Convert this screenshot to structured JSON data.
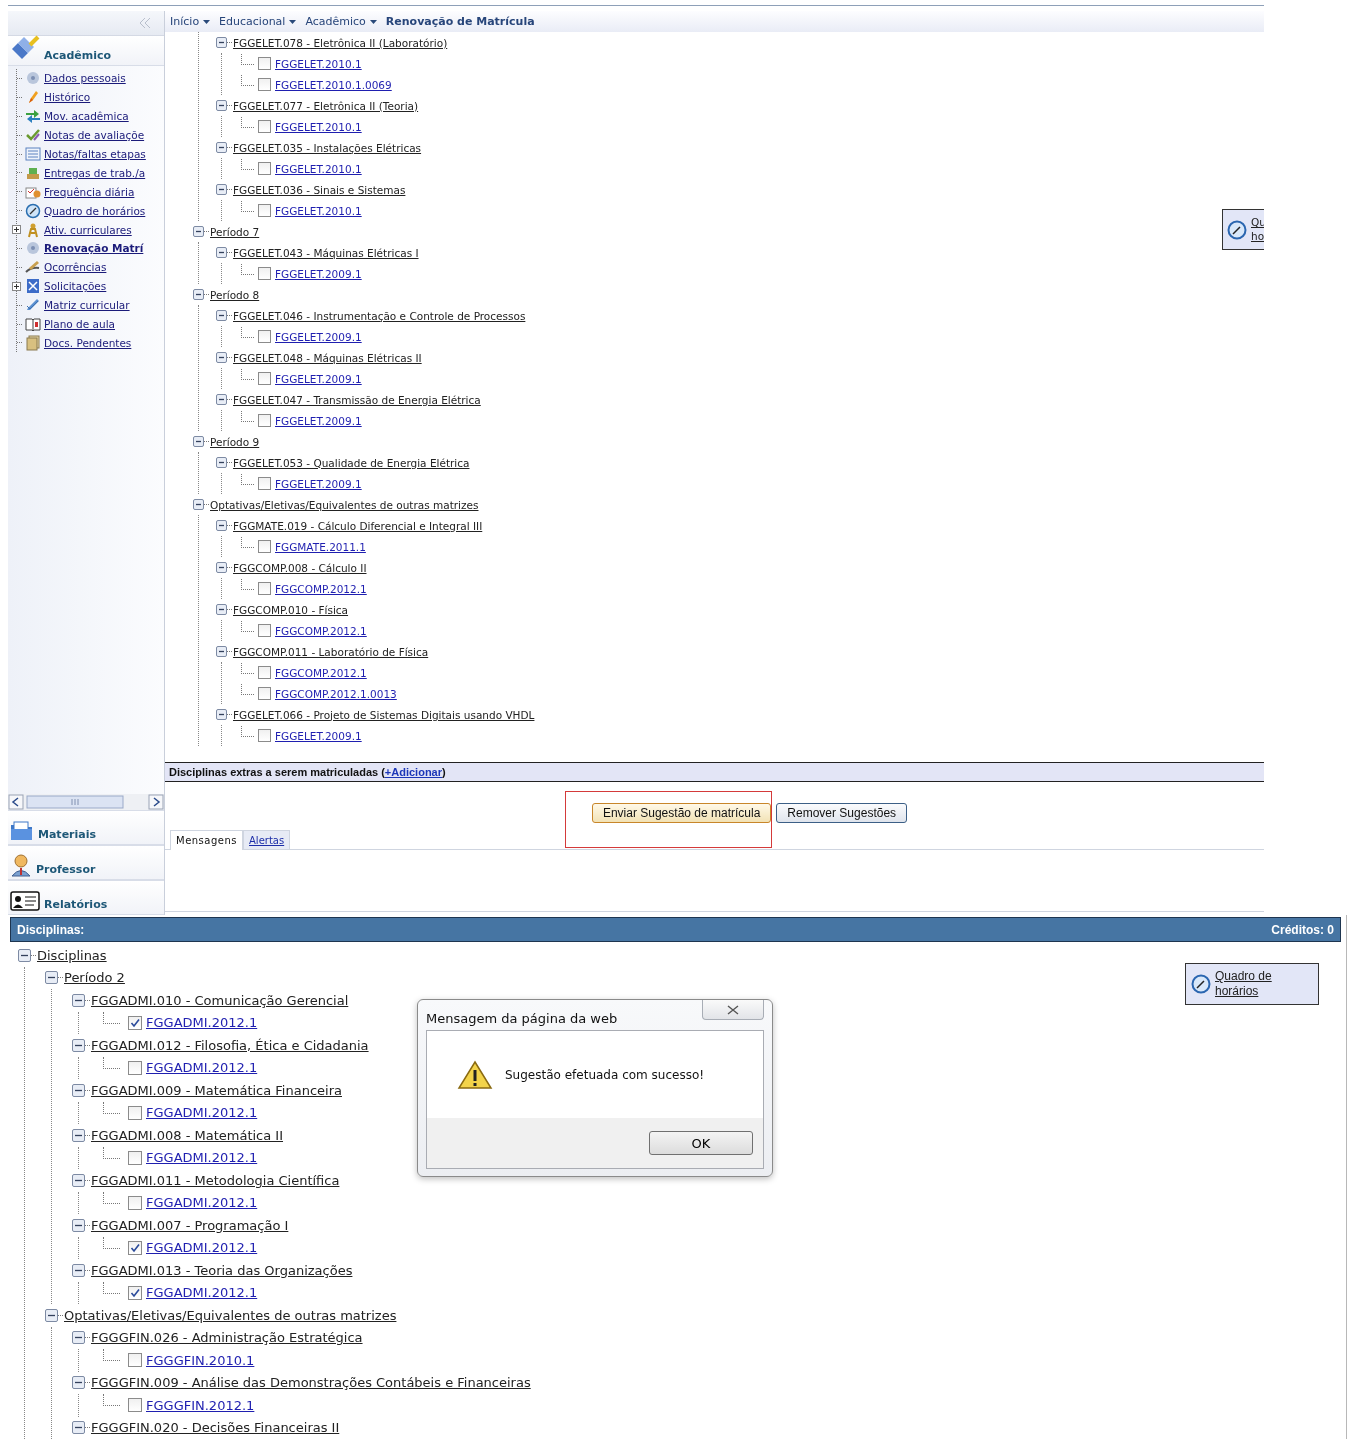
{
  "sidebar": {
    "section": {
      "title": "Acadêmico",
      "items": [
        {
          "label": "Dados pessoais",
          "expandable": false,
          "selected": false
        },
        {
          "label": "Histórico",
          "expandable": false,
          "selected": false
        },
        {
          "label": "Mov. acadêmica",
          "expandable": false,
          "selected": false
        },
        {
          "label": "Notas de avaliaçõe",
          "expandable": false,
          "selected": false
        },
        {
          "label": "Notas/faltas etapas",
          "expandable": false,
          "selected": false
        },
        {
          "label": "Entregas de trab./a",
          "expandable": false,
          "selected": false
        },
        {
          "label": "Frequência diária",
          "expandable": false,
          "selected": false
        },
        {
          "label": "Quadro de horários",
          "expandable": false,
          "selected": false
        },
        {
          "label": "Ativ. curriculares",
          "expandable": true,
          "selected": false
        },
        {
          "label": "Renovação Matrí",
          "expandable": false,
          "selected": true
        },
        {
          "label": "Ocorrências",
          "expandable": false,
          "selected": false
        },
        {
          "label": "Solicitações",
          "expandable": true,
          "selected": false
        },
        {
          "label": "Matriz curricular",
          "expandable": false,
          "selected": false
        },
        {
          "label": "Plano de aula",
          "expandable": false,
          "selected": false
        },
        {
          "label": "Docs. Pendentes",
          "expandable": false,
          "selected": false
        }
      ]
    },
    "other_sections": [
      {
        "title": "Materiais"
      },
      {
        "title": "Professor"
      },
      {
        "title": "Relatórios"
      }
    ]
  },
  "breadcrumb": [
    {
      "label": "Início",
      "kind": "menu"
    },
    {
      "label": "Educacional",
      "kind": "menu"
    },
    {
      "label": "Acadêmico",
      "kind": "menu"
    },
    {
      "label": "Renovação de Matrícula",
      "kind": "current"
    }
  ],
  "tree": {
    "nodes": [
      {
        "kind": "continued",
        "children": [
          {
            "kind": "course",
            "label": "FGGELET.078 - Eletrônica II (Laboratório)",
            "expanded": true,
            "children": [
              {
                "kind": "class",
                "label": "FGGELET.2010.1",
                "checked": false
              },
              {
                "kind": "class",
                "label": "FGGELET.2010.1.0069",
                "checked": false
              }
            ]
          },
          {
            "kind": "course",
            "label": "FGGELET.077 - Eletrônica II (Teoria)",
            "expanded": true,
            "children": [
              {
                "kind": "class",
                "label": "FGGELET.2010.1",
                "checked": false
              }
            ]
          },
          {
            "kind": "course",
            "label": "FGGELET.035 - Instalações Elétricas",
            "expanded": true,
            "children": [
              {
                "kind": "class",
                "label": "FGGELET.2010.1",
                "checked": false
              }
            ]
          },
          {
            "kind": "course",
            "label": "FGGELET.036 - Sinais e Sistemas",
            "expanded": true,
            "children": [
              {
                "kind": "class",
                "label": "FGGELET.2010.1",
                "checked": false
              }
            ]
          }
        ]
      },
      {
        "kind": "group",
        "label": "Período 7",
        "expanded": true,
        "children": [
          {
            "kind": "course",
            "label": "FGGELET.043 - Máquinas Elétricas I",
            "expanded": true,
            "children": [
              {
                "kind": "class",
                "label": "FGGELET.2009.1",
                "checked": false
              }
            ]
          }
        ]
      },
      {
        "kind": "group",
        "label": "Período 8",
        "expanded": true,
        "children": [
          {
            "kind": "course",
            "label": "FGGELET.046 - Instrumentação e Controle de Processos",
            "expanded": true,
            "children": [
              {
                "kind": "class",
                "label": "FGGELET.2009.1",
                "checked": false
              }
            ]
          },
          {
            "kind": "course",
            "label": "FGGELET.048 - Máquinas Elétricas II",
            "expanded": true,
            "children": [
              {
                "kind": "class",
                "label": "FGGELET.2009.1",
                "checked": false
              }
            ]
          },
          {
            "kind": "course",
            "label": "FGGELET.047 - Transmissão de Energia Elétrica",
            "expanded": true,
            "children": [
              {
                "kind": "class",
                "label": "FGGELET.2009.1",
                "checked": false
              }
            ]
          }
        ]
      },
      {
        "kind": "group",
        "label": "Período 9",
        "expanded": true,
        "children": [
          {
            "kind": "course",
            "label": "FGGELET.053 - Qualidade de Energia Elétrica",
            "expanded": true,
            "children": [
              {
                "kind": "class",
                "label": "FGGELET.2009.1",
                "checked": false
              }
            ]
          }
        ]
      },
      {
        "kind": "group",
        "label": "Optativas/Eletivas/Equivalentes de outras matrizes",
        "expanded": true,
        "children": [
          {
            "kind": "course",
            "label": "FGGMATE.019 - Cálculo Diferencial e Integral III",
            "expanded": true,
            "children": [
              {
                "kind": "class",
                "label": "FGGMATE.2011.1",
                "checked": false
              }
            ]
          },
          {
            "kind": "course",
            "label": "FGGCOMP.008 - Cálculo II",
            "expanded": true,
            "children": [
              {
                "kind": "class",
                "label": "FGGCOMP.2012.1",
                "checked": false
              }
            ]
          },
          {
            "kind": "course",
            "label": "FGGCOMP.010 - Física",
            "expanded": true,
            "children": [
              {
                "kind": "class",
                "label": "FGGCOMP.2012.1",
                "checked": false
              }
            ]
          },
          {
            "kind": "course",
            "label": "FGGCOMP.011 - Laboratório de Física",
            "expanded": true,
            "children": [
              {
                "kind": "class",
                "label": "FGGCOMP.2012.1",
                "checked": false
              },
              {
                "kind": "class",
                "label": "FGGCOMP.2012.1.0013",
                "checked": false
              }
            ]
          },
          {
            "kind": "course",
            "label": "FGGELET.066 - Projeto de Sistemas Digitais usando VHDL",
            "expanded": true,
            "children": [
              {
                "kind": "class",
                "label": "FGGELET.2009.1",
                "checked": false
              }
            ]
          }
        ]
      }
    ]
  },
  "schedule_widget": {
    "lines": [
      "Qu",
      "ho"
    ]
  },
  "extras_bar": {
    "text_before": "Disciplinas extras a serem matriculadas  (",
    "link": "+Adicionar",
    "text_after": ")"
  },
  "actions": [
    {
      "label": "Enviar Sugestão de matrícula",
      "highlighted": true
    },
    {
      "label": "Remover Sugestões",
      "highlighted": false
    }
  ],
  "message_tabs": [
    {
      "label": "Mensagens",
      "selected": true
    },
    {
      "label": "Alertas",
      "selected": false
    }
  ],
  "enrollment_panel": {
    "title": "Disciplinas:",
    "credits": "Créditos: 0",
    "schedule_widget": {
      "lines": [
        "Quadro de",
        "horários"
      ]
    },
    "tree": {
      "nodes": [
        {
          "kind": "group",
          "label": "Disciplinas",
          "expanded": true,
          "children": [
            {
              "kind": "group",
              "label": "Período 2",
              "expanded": true,
              "children": [
                {
                  "kind": "course",
                  "label": "FGGADMI.010 - Comunicação Gerencial",
                  "expanded": true,
                  "children": [
                    {
                      "kind": "class",
                      "label": "FGGADMI.2012.1",
                      "checked": true
                    }
                  ]
                },
                {
                  "kind": "course",
                  "label": "FGGADMI.012 - Filosofia, Ética e Cidadania",
                  "expanded": true,
                  "children": [
                    {
                      "kind": "class",
                      "label": "FGGADMI.2012.1",
                      "checked": false
                    }
                  ]
                },
                {
                  "kind": "course",
                  "label": "FGGADMI.009 - Matemática Financeira",
                  "expanded": true,
                  "children": [
                    {
                      "kind": "class",
                      "label": "FGGADMI.2012.1",
                      "checked": false
                    }
                  ]
                },
                {
                  "kind": "course",
                  "label": "FGGADMI.008 - Matemática II",
                  "expanded": true,
                  "children": [
                    {
                      "kind": "class",
                      "label": "FGGADMI.2012.1",
                      "checked": false
                    }
                  ]
                },
                {
                  "kind": "course",
                  "label": "FGGADMI.011 - Metodologia Científica",
                  "expanded": true,
                  "children": [
                    {
                      "kind": "class",
                      "label": "FGGADMI.2012.1",
                      "checked": false
                    }
                  ]
                },
                {
                  "kind": "course",
                  "label": "FGGADMI.007 - Programação I",
                  "expanded": true,
                  "children": [
                    {
                      "kind": "class",
                      "label": "FGGADMI.2012.1",
                      "checked": true
                    }
                  ]
                },
                {
                  "kind": "course",
                  "label": "FGGADMI.013 - Teoria das Organizações",
                  "expanded": true,
                  "children": [
                    {
                      "kind": "class",
                      "label": "FGGADMI.2012.1",
                      "checked": true
                    }
                  ]
                }
              ]
            },
            {
              "kind": "group",
              "label": "Optativas/Eletivas/Equivalentes de outras matrizes",
              "expanded": true,
              "children": [
                {
                  "kind": "course",
                  "label": "FGGGFIN.026 - Administração Estratégica",
                  "expanded": true,
                  "children": [
                    {
                      "kind": "class",
                      "label": "FGGGFIN.2010.1",
                      "checked": false
                    }
                  ]
                },
                {
                  "kind": "course",
                  "label": "FGGGFIN.009 - Análise das Demonstrações Contábeis e Financeiras",
                  "expanded": true,
                  "children": [
                    {
                      "kind": "class",
                      "label": "FGGGFIN.2012.1",
                      "checked": false
                    }
                  ]
                },
                {
                  "kind": "course",
                  "label": "FGGGFIN.020 - Decisões Financeiras II",
                  "expanded": true
                }
              ]
            }
          ]
        }
      ]
    },
    "dialog": {
      "title": "Mensagem da página da web",
      "message": "Sugestão efetuada com sucesso!",
      "button": "OK"
    }
  }
}
